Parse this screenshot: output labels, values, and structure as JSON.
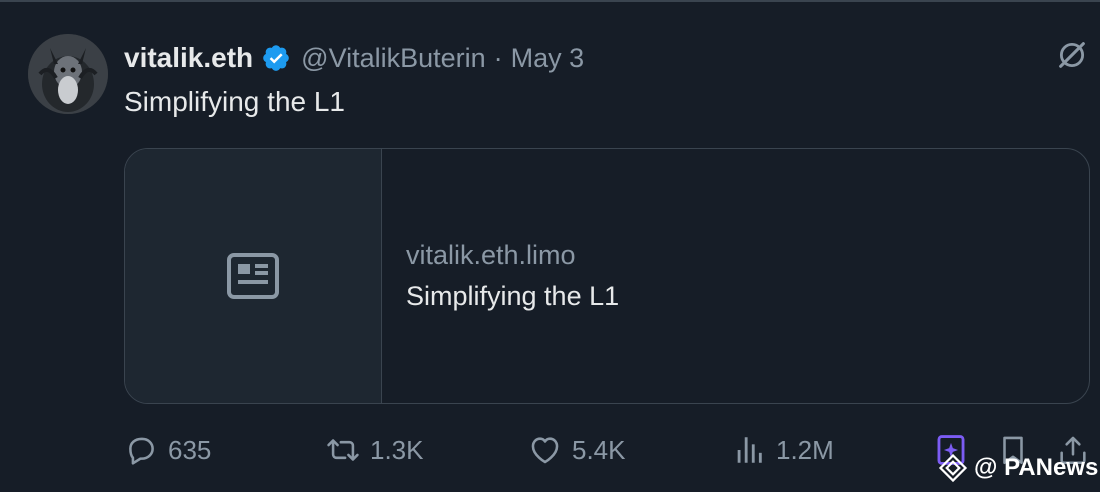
{
  "tweet": {
    "display_name": "vitalik.eth",
    "handle": "@VitalikButerin",
    "separator": "·",
    "date": "May 3",
    "text": "Simplifying the L1",
    "avatar_icon": "avatar-image",
    "verified_icon": "verified-badge-icon",
    "verified_color": "#1d9bf0",
    "grok_icon": "grok-icon"
  },
  "card": {
    "thumbnail_icon": "article-icon",
    "domain": "vitalik.eth.limo",
    "title": "Simplifying the L1"
  },
  "actions": {
    "reply": {
      "icon": "reply-icon",
      "count": "635"
    },
    "retweet": {
      "icon": "retweet-icon",
      "count": "1.3K"
    },
    "like": {
      "icon": "heart-icon",
      "count": "5.4K"
    },
    "views": {
      "icon": "views-icon",
      "count": "1.2M"
    },
    "grok_image": {
      "icon": "grok-image-icon",
      "color": "#7c5cf4"
    },
    "bookmark": {
      "icon": "bookmark-icon"
    },
    "share": {
      "icon": "share-icon"
    }
  },
  "watermark": {
    "text": "@ PANews",
    "icon": "panews-logo-icon"
  },
  "colors": {
    "background": "#161d27",
    "primary_text": "#e7e9ea",
    "secondary_text": "#8b98a5",
    "border": "#3a444f"
  }
}
